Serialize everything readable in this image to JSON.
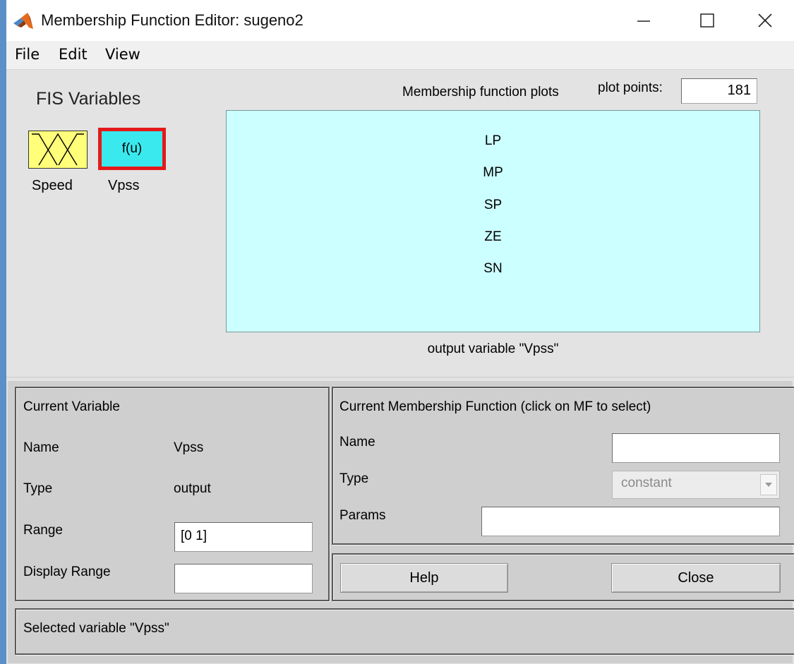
{
  "window": {
    "title": "Membership Function Editor: sugeno2",
    "icon": "matlab-logo-icon"
  },
  "menu": [
    {
      "label": "File"
    },
    {
      "label": "Edit"
    },
    {
      "label": "View"
    }
  ],
  "fis_variables": {
    "heading": "FIS Variables",
    "inputs": [
      {
        "label": "Speed",
        "icon": "membership-curves-icon"
      }
    ],
    "outputs": [
      {
        "label": "Vpss",
        "symbol": "f(u)",
        "selected": true
      }
    ]
  },
  "plot": {
    "title": "Membership function plots",
    "plot_points_label": "plot points:",
    "plot_points_value": "181",
    "mf_labels": [
      "LP",
      "MP",
      "SP",
      "ZE",
      "SN"
    ],
    "caption": "output variable \"Vpss\"",
    "background": "#ccffff"
  },
  "current_variable": {
    "heading": "Current Variable",
    "name_label": "Name",
    "name_value": "Vpss",
    "type_label": "Type",
    "type_value": "output",
    "range_label": "Range",
    "range_value": "[0 1]",
    "display_range_label": "Display Range",
    "display_range_value": ""
  },
  "current_mf": {
    "heading": "Current Membership Function (click on MF to select)",
    "name_label": "Name",
    "name_value": "",
    "type_label": "Type",
    "type_value": "constant",
    "params_label": "Params",
    "params_value": ""
  },
  "buttons": {
    "help": "Help",
    "close": "Close"
  },
  "status": {
    "text": "Selected variable \"Vpss\""
  },
  "colors": {
    "input_variable": "#ffff7a",
    "output_variable": "#3ae9ee",
    "selection_border": "#e31a1a"
  }
}
